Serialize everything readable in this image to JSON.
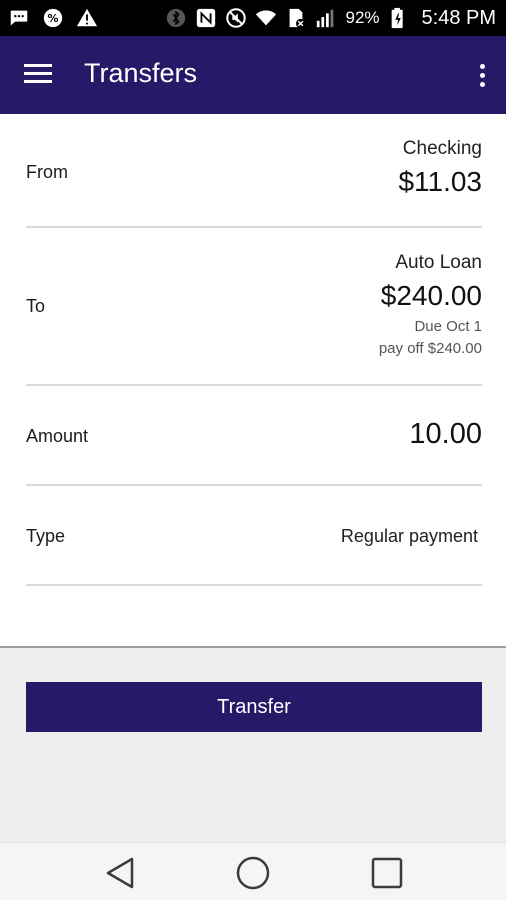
{
  "status_bar": {
    "battery_percent": "92%",
    "time": "5:48 PM",
    "left_icons": [
      "message-icon",
      "percent-icon",
      "warning-icon"
    ],
    "right_icons": [
      "bluetooth-icon",
      "nfc-icon",
      "mute-icon",
      "wifi-icon",
      "sim-icon",
      "signal-icon",
      "battery-icon"
    ]
  },
  "app_bar": {
    "title": "Transfers",
    "color": "#271968",
    "menu_icon": "hamburger-menu-icon",
    "overflow_icon": "more-vert-icon"
  },
  "form": {
    "from": {
      "label": "From",
      "account_name": "Checking",
      "balance": "$11.03"
    },
    "to": {
      "label": "To",
      "account_name": "Auto Loan",
      "balance": "$240.00",
      "due": "Due Oct 1",
      "payoff": "pay off $240.00"
    },
    "amount": {
      "label": "Amount",
      "value": "10.00"
    },
    "type": {
      "label": "Type",
      "value": "Regular payment"
    }
  },
  "actions": {
    "transfer_label": "Transfer"
  },
  "nav_bar": {
    "icons": [
      "back-icon",
      "home-icon",
      "recent-apps-icon"
    ]
  }
}
